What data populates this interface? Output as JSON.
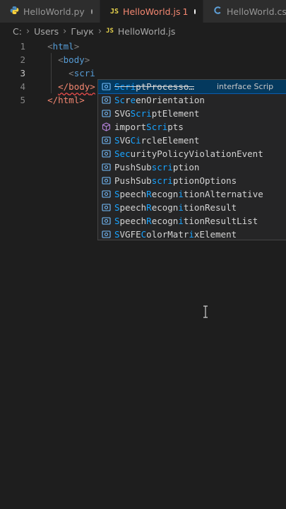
{
  "tabs": [
    {
      "name": "HelloWorld.py",
      "icon": "python-icon",
      "dirty": true
    },
    {
      "name": "HelloWorld.js",
      "icon": "js-icon",
      "problems": "1",
      "dirty": true,
      "active": true
    },
    {
      "name": "HelloWorld.cs",
      "icon": "csharp-icon",
      "dirty": false
    }
  ],
  "tab_icons": {
    "js": "JS",
    "cs": "C"
  },
  "breadcrumb": {
    "parts": [
      "C:",
      "Users",
      "Гыук"
    ],
    "file_icon": "JS",
    "file": "HelloWorld.js"
  },
  "editor": {
    "line_numbers": [
      "1",
      "2",
      "3",
      "4",
      "5"
    ],
    "current_line": 3,
    "lines": {
      "l1_tag": "html",
      "l2_tag": "body",
      "l3_partial": "scri",
      "l4_tag": "body",
      "l5_tag": "html"
    }
  },
  "suggest": {
    "selected_detail": "interface Scrip",
    "items": [
      {
        "pre": "",
        "match": "Scri",
        "post": "ptProcesso…",
        "kind": "interface",
        "selected": true
      },
      {
        "pre": "",
        "match": "Sc",
        "mid": "r",
        "match2": "",
        "post": "eenOrientation",
        "kind": "interface"
      },
      {
        "pre": "SVG",
        "match": "Scri",
        "post": "ptElement",
        "kind": "interface"
      },
      {
        "pre": "import",
        "match": "Scri",
        "post": "pts",
        "kind": "module"
      },
      {
        "pre": "SVG",
        "match": "C",
        "mid": "",
        "post": "ircleElement",
        "kind": "interface"
      },
      {
        "pre": "",
        "match": "Secur",
        "post": "ityPolicyViolationEvent",
        "kind": "interface"
      },
      {
        "pre": "PushSub",
        "match": "scri",
        "post": "ption",
        "kind": "interface"
      },
      {
        "pre": "PushSub",
        "match": "scri",
        "post": "ptionOptions",
        "kind": "interface"
      },
      {
        "pre": "",
        "match": "S",
        "post": "peechRecognitionAlternative",
        "kind": "interface"
      },
      {
        "pre": "",
        "match": "S",
        "post": "peechRecognitionResult",
        "kind": "interface"
      },
      {
        "pre": "",
        "match": "S",
        "post": "peechRecognitionResultList",
        "kind": "interface"
      },
      {
        "pre": "SVGFE",
        "match": "C",
        "post": "olorMatrixElement",
        "kind": "interface"
      }
    ],
    "labels": [
      "ScriptProcesso…",
      "ScreenOrientation",
      "SVGScriptElement",
      "importScripts",
      "SVGCircleElement",
      "SecurityPolicyViolationEvent",
      "PushSubscription",
      "PushSubscriptionOptions",
      "SpeechRecognitionAlternative",
      "SpeechRecognitionResult",
      "SpeechRecognitionResultList",
      "SVGFEColorMatrixElement"
    ]
  },
  "colors": {
    "accent_error": "#f48771",
    "match_highlight": "#18a3ff",
    "selection": "#04395e"
  }
}
